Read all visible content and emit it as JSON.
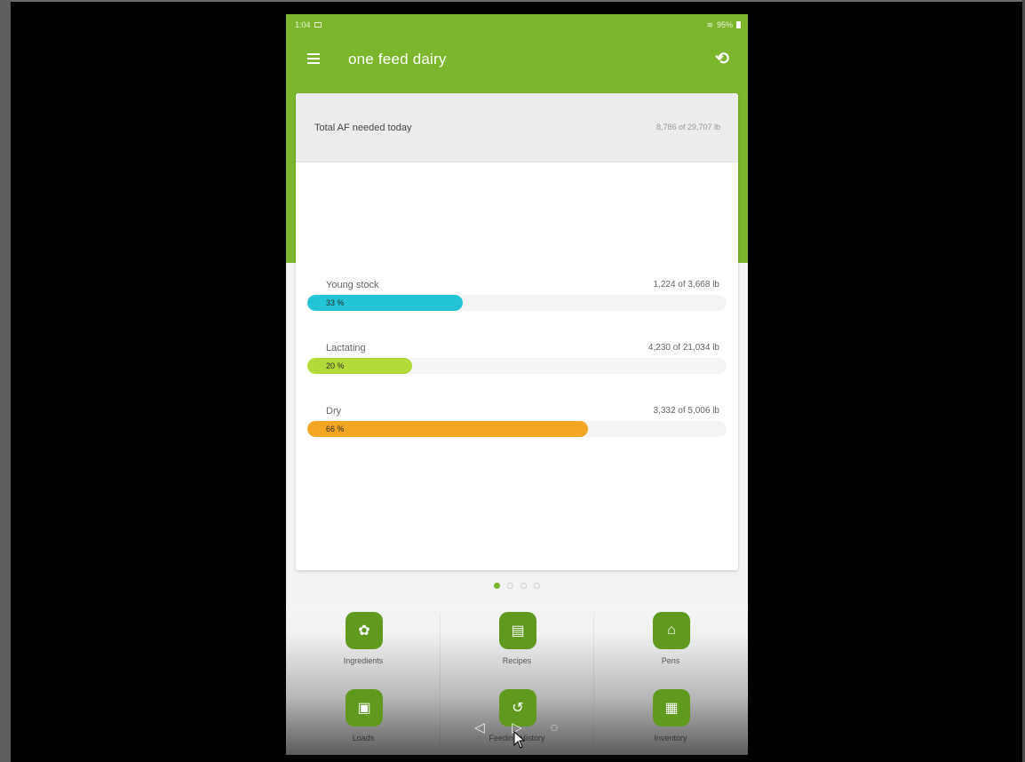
{
  "status_bar": {
    "time": "1:04",
    "battery": "95%"
  },
  "toolbar": {
    "title": "one feed dairy"
  },
  "summary": {
    "label": "Total AF needed today",
    "value": "8,786 of 29,707 lb"
  },
  "groups": [
    {
      "label": "Young stock",
      "value": "1,224 of 3,668 lb",
      "percent_label": "33 %",
      "fraction": 0.37,
      "color": "#22c4d6"
    },
    {
      "label": "Lactating",
      "value": "4,230 of 21,034 lb",
      "percent_label": "20 %",
      "fraction": 0.25,
      "color": "#b4da3a"
    },
    {
      "label": "Dry",
      "value": "3,332 of 5,006 lb",
      "percent_label": "66 %",
      "fraction": 0.67,
      "color": "#f2a623"
    }
  ],
  "pager": {
    "count": 4,
    "active": 0
  },
  "tiles": [
    {
      "label": "Ingredients",
      "icon": "sprout-icon"
    },
    {
      "label": "Recipes",
      "icon": "clipboard-icon"
    },
    {
      "label": "Pens",
      "icon": "barn-icon"
    },
    {
      "label": "Loads",
      "icon": "truck-icon"
    },
    {
      "label": "Feeding History",
      "icon": "history-icon"
    },
    {
      "label": "Inventory",
      "icon": "inventory-icon"
    }
  ],
  "colors": {
    "primary": "#7cb62d",
    "tile_icon": "#5f9a1e"
  }
}
